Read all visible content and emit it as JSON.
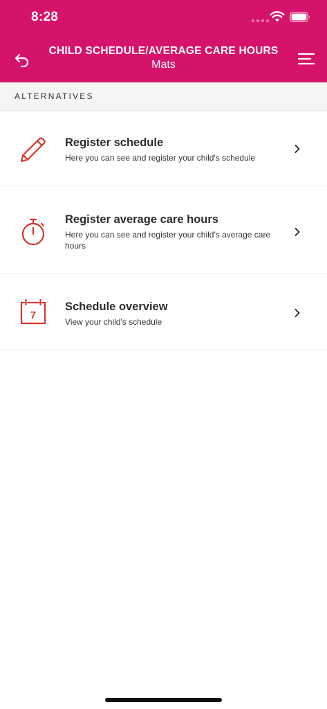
{
  "status_bar": {
    "time": "8:28"
  },
  "nav": {
    "title": "CHILD SCHEDULE/AVERAGE CARE HOURS",
    "subtitle": "Mats"
  },
  "section": {
    "label": "ALTERNATIVES"
  },
  "items": [
    {
      "title": "Register schedule",
      "description": "Here you can see and register your child's schedule",
      "icon": "pencil-icon"
    },
    {
      "title": "Register average care hours",
      "description": "Here you can see and register your child's average care hours",
      "icon": "stopwatch-icon"
    },
    {
      "title": "Schedule overview",
      "description": "View your child's schedule",
      "icon": "calendar-icon",
      "icon_text": "7"
    }
  ],
  "colors": {
    "brand": "#d6136a",
    "icon_red": "#d9342b",
    "section_bg": "#f5f5f5"
  }
}
